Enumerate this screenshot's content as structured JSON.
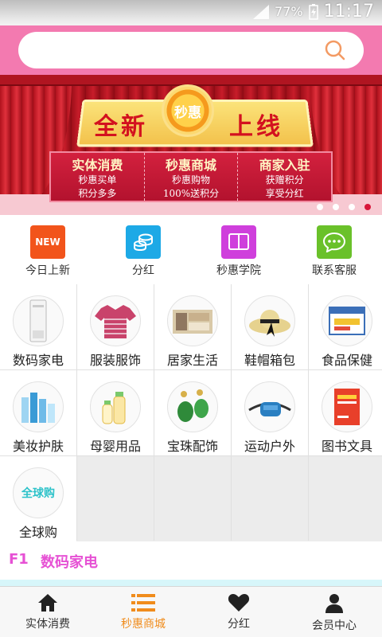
{
  "status_bar": {
    "battery": "77%",
    "time": "11:17"
  },
  "search": {
    "placeholder": ""
  },
  "banner": {
    "headline_left": "全新",
    "headline_right": "上线",
    "badge": "秒惠",
    "cards": [
      {
        "title": "实体消费",
        "line1": "秒惠买单",
        "line2": "积分多多"
      },
      {
        "title": "秒惠商城",
        "line1": "秒惠购物",
        "line2": "100%送积分"
      },
      {
        "title": "商家入驻",
        "line1": "获赠积分",
        "line2": "享受分红"
      }
    ],
    "dot_count": 4,
    "active_dot": 3
  },
  "quick_links": [
    {
      "label": "今日上新",
      "icon": "new-badge-icon",
      "badge": "NEW"
    },
    {
      "label": "分红",
      "icon": "coins-icon"
    },
    {
      "label": "秒惠学院",
      "icon": "book-icon"
    },
    {
      "label": "联系客服",
      "icon": "chat-bubble-icon"
    }
  ],
  "categories": [
    {
      "label": "数码家电",
      "image": "air-conditioner"
    },
    {
      "label": "服装服饰",
      "image": "polo-shirt"
    },
    {
      "label": "居家生活",
      "image": "home-goods"
    },
    {
      "label": "鞋帽箱包",
      "image": "sun-hat"
    },
    {
      "label": "食品保健",
      "image": "supplement-box"
    },
    {
      "label": "美妆护肤",
      "image": "skincare-bottles"
    },
    {
      "label": "母婴用品",
      "image": "baby-bottles"
    },
    {
      "label": "宝珠配饰",
      "image": "jade-earrings"
    },
    {
      "label": "运动户外",
      "image": "waist-bag"
    },
    {
      "label": "图书文具",
      "image": "book"
    },
    {
      "label": "全球购",
      "image_text": "全球购"
    }
  ],
  "floor": {
    "number": "F1",
    "title": "数码家电"
  },
  "tab_bar": [
    {
      "label": "实体消费",
      "icon": "home-icon",
      "active": false
    },
    {
      "label": "秒惠商城",
      "icon": "list-icon",
      "active": true
    },
    {
      "label": "分红",
      "icon": "heart-icon",
      "active": false
    },
    {
      "label": "会员中心",
      "icon": "person-icon",
      "active": false
    }
  ],
  "colors": {
    "header_pink": "#f37ab0",
    "floor_magenta": "#e651d4",
    "tab_active": "#f08c1c"
  }
}
